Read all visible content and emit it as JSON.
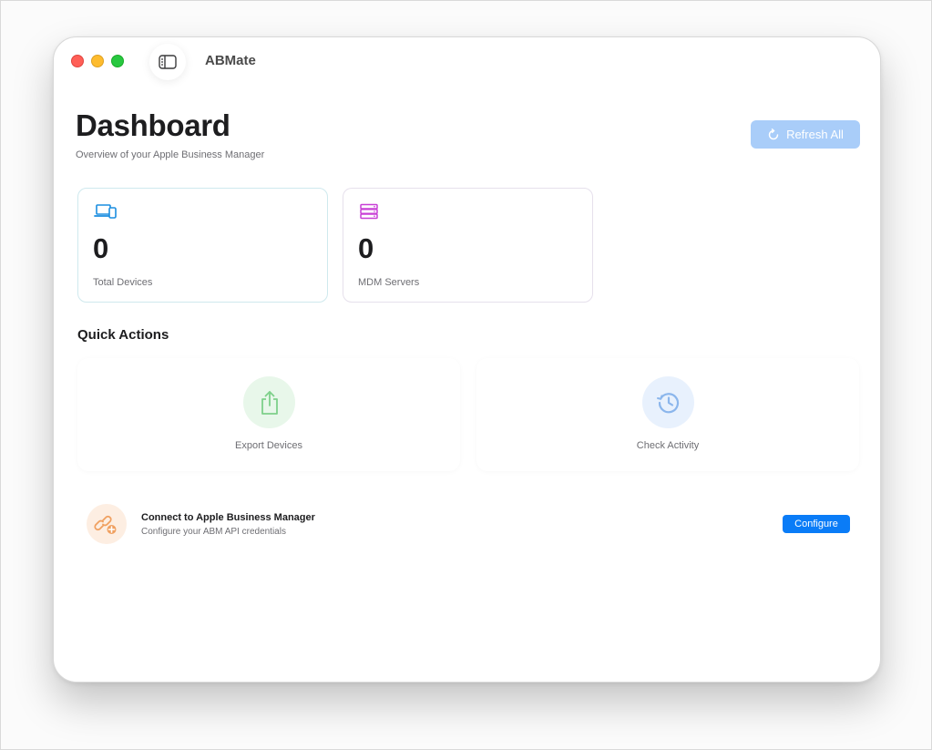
{
  "window": {
    "app_title": "ABMate"
  },
  "header": {
    "title": "Dashboard",
    "subtitle": "Overview of your Apple Business Manager",
    "refresh_label": "Refresh All"
  },
  "stats": [
    {
      "value": "0",
      "label": "Total Devices",
      "icon": "laptop-phone-icon",
      "color": "#1a8de0"
    },
    {
      "value": "0",
      "label": "MDM Servers",
      "icon": "server-icon",
      "color": "#c83fd6"
    }
  ],
  "quick_actions": {
    "title": "Quick Actions",
    "items": [
      {
        "label": "Export Devices",
        "icon": "share-upload-icon",
        "color": "#7ed08a"
      },
      {
        "label": "Check Activity",
        "icon": "history-clock-icon",
        "color": "#8bb6ec"
      }
    ]
  },
  "connect": {
    "title": "Connect to Apple Business Manager",
    "subtitle": "Configure your ABM API credentials",
    "button_label": "Configure",
    "icon": "link-add-icon",
    "color": "#f0a060"
  },
  "colors": {
    "accent": "#0a7cf7",
    "refresh_disabled": "#a9cdf9"
  }
}
